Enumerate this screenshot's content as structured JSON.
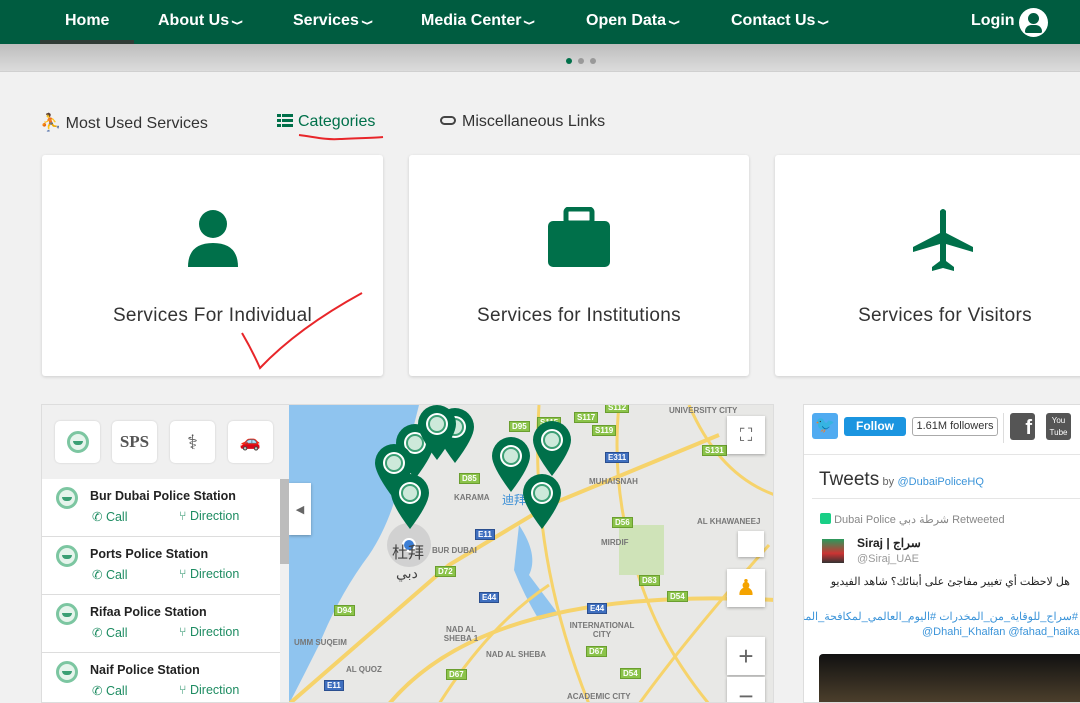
{
  "nav": {
    "items": [
      {
        "label": "Home"
      },
      {
        "label": "About Us"
      },
      {
        "label": "Services"
      },
      {
        "label": "Media Center"
      },
      {
        "label": "Open Data"
      },
      {
        "label": "Contact Us"
      }
    ],
    "login": "Login",
    "chevron": "⌄"
  },
  "tabs": [
    {
      "label": "Most Used Services",
      "icon": "running-person-icon"
    },
    {
      "label": "Categories",
      "icon": "list-icon",
      "active": true
    },
    {
      "label": "Miscellaneous Links",
      "icon": "link-icon"
    }
  ],
  "cards": [
    {
      "label": "Services For Individual",
      "icon": "person-icon"
    },
    {
      "label": "Services for Institutions",
      "icon": "briefcase-icon"
    },
    {
      "label": "Services for Visitors",
      "icon": "airplane-icon"
    }
  ],
  "locator": {
    "filters": [
      "police-emblem-icon",
      "SPS",
      "pharmacy-icon",
      "car-accident-icon"
    ],
    "stations": [
      {
        "name": "Bur Dubai Police Station",
        "call": "Call",
        "direction": "Direction"
      },
      {
        "name": "Ports Police Station",
        "call": "Call",
        "direction": "Direction"
      },
      {
        "name": "Rifaa Police Station",
        "call": "Call",
        "direction": "Direction"
      },
      {
        "name": "Naif Police Station",
        "call": "Call",
        "direction": "Direction"
      }
    ]
  },
  "map": {
    "labels": [
      "UNIVERSITY CITY",
      "MUHAISNAH",
      "AL KHAWANEEJ",
      "MIRDIF",
      "BUR DUBAI",
      "KARAMA",
      "INTERNATIONAL CITY",
      "NAD AL SHEBA 1",
      "NAD AL SHEBA",
      "UMM SUQEIM",
      "AL QUOZ",
      "ACADEMIC CITY",
      "杜拜",
      "迪拜国际",
      "دبي"
    ],
    "roads": [
      "S112",
      "D95",
      "S115",
      "S117",
      "S119",
      "S131",
      "E311",
      "D85",
      "D56",
      "E11",
      "D72",
      "D83",
      "D54",
      "E44",
      "E44",
      "D94",
      "D67",
      "D67",
      "D54",
      "E11"
    ],
    "zoom_in": "+",
    "zoom_out": "−"
  },
  "twitter": {
    "follow": "Follow",
    "followers": "1.61M followers",
    "tweets_title": "Tweets",
    "by": "by",
    "handle": "@DubaiPoliceHQ",
    "retweeted_by": "Dubai Police شرطة دبي Retweeted",
    "author_name": "Siraj | سراج",
    "author_handle": "@Siraj_UAE",
    "text": "هل لاحظت أي تغيير مفاجئ على أبنائك؟ شاهد الفيديو",
    "hashtags": "#سراج_للوقاية_من_المخدرات #اليوم_العالمي_لمكافحة_المخدرات",
    "mentions": "@Dhahi_Khalfan @fahad_haika"
  },
  "colors": {
    "brand": "#005c40",
    "accent": "#00704a",
    "annotation": "#e8262a",
    "twitter": "#1da1f2"
  }
}
